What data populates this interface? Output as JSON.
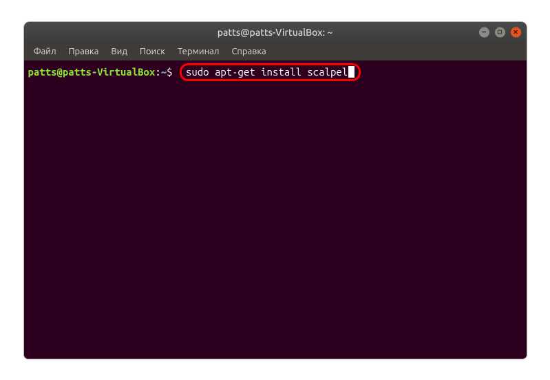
{
  "window": {
    "title": "patts@patts-VirtualBox: ~"
  },
  "menu": {
    "file": "Файл",
    "edit": "Правка",
    "view": "Вид",
    "search": "Поиск",
    "terminal": "Терминал",
    "help": "Справка"
  },
  "prompt": {
    "user_host": "patts@patts-VirtualBox",
    "colon": ":",
    "path": "~",
    "symbol": "$"
  },
  "command": "sudo apt-get install scalpel",
  "colors": {
    "background": "#2c001e",
    "prompt_user": "#8ae234",
    "prompt_path": "#729fcf",
    "text": "#ffffff",
    "highlight_border": "#ff0000",
    "close_btn": "#e95420"
  }
}
